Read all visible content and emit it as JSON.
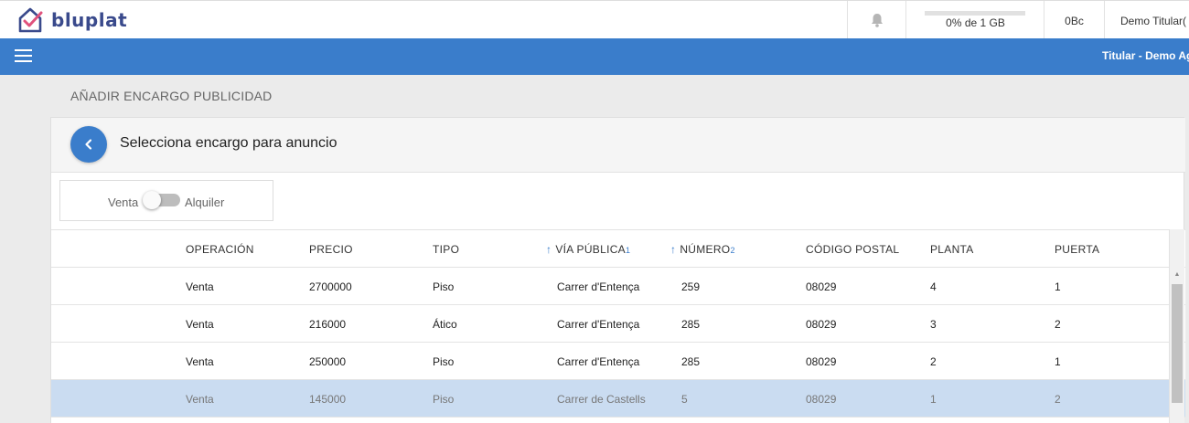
{
  "app": {
    "logo_text": "bluplat",
    "brand_color": "#3a7dcb"
  },
  "topbar": {
    "storage_text": "0% de 1 GB",
    "storage_progress": 0,
    "bc_label": "0Bc",
    "user_label": "Demo Titular(",
    "icons": [
      "bell-icon"
    ]
  },
  "bluebar": {
    "right_title": "Titular - Demo Ag"
  },
  "page": {
    "title": "AÑADIR ENCARGO PUBLICIDAD"
  },
  "card": {
    "title": "Selecciona encargo para anuncio",
    "toggle": {
      "left_label": "Venta",
      "right_label": "Alquiler",
      "selected": "Venta"
    }
  },
  "table": {
    "columns": [
      {
        "label": "OPERACIÓN"
      },
      {
        "label": "PRECIO"
      },
      {
        "label": "TIPO"
      },
      {
        "label": "VÍA PÚBLICA",
        "sort_order": "1"
      },
      {
        "label": "NÚMERO",
        "sort_order": "2"
      },
      {
        "label": "CÓDIGO POSTAL"
      },
      {
        "label": "PLANTA"
      },
      {
        "label": "PUERTA"
      }
    ],
    "rows": [
      {
        "cells": [
          "Venta",
          "2700000",
          "Piso",
          "Carrer d'Entença",
          "259",
          "08029",
          "4",
          "1"
        ],
        "selected": false
      },
      {
        "cells": [
          "Venta",
          "216000",
          "Ático",
          "Carrer d'Entença",
          "285",
          "08029",
          "3",
          "2"
        ],
        "selected": false
      },
      {
        "cells": [
          "Venta",
          "250000",
          "Piso",
          "Carrer d'Entença",
          "285",
          "08029",
          "2",
          "1"
        ],
        "selected": false
      },
      {
        "cells": [
          "Venta",
          "145000",
          "Piso",
          "Carrer de Castells",
          "5",
          "08029",
          "1",
          "2"
        ],
        "selected": true
      }
    ]
  }
}
